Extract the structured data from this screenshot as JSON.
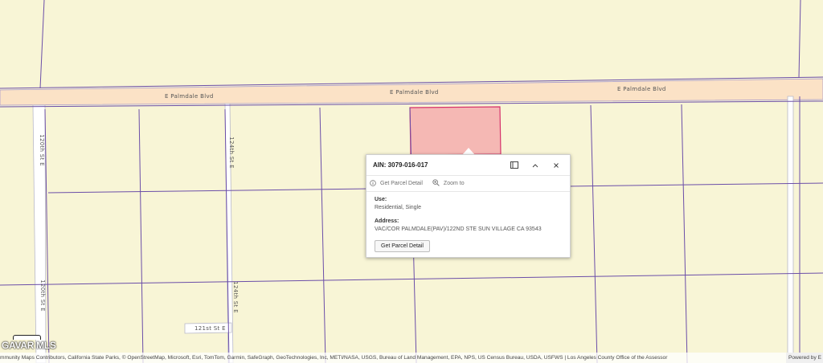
{
  "roads": {
    "palmdale_left": "E Palmdale Blvd",
    "palmdale_mid": "E Palmdale Blvd",
    "palmdale_right": "E Palmdale Blvd",
    "st_120th_top": "120th St E",
    "st_120th_bottom": "120th St E",
    "st_121st": "121st St E",
    "st_124th_top": "124th St E",
    "st_124th_bottom": "124th St E"
  },
  "popup": {
    "title": "AIN: 3079-016-017",
    "dock_icon": "dock-icon",
    "collapse_icon": "chevron-up-icon",
    "close_icon": "close-icon",
    "action_info_label": "Get Parcel Detail",
    "action_zoom_label": "Zoom to",
    "use_label": "Use:",
    "use_value": "Residential, Single",
    "address_label": "Address:",
    "address_value": "VAC/COR PALMDALE(PAV)/122ND STE SUN VILLAGE CA 93543",
    "detail_button": "Get Parcel Detail"
  },
  "attribution": "mmunity Maps Contributors, California State Parks, © OpenStreetMap, Microsoft, Esri, TomTom, Garmin, SafeGraph, GeoTechnologies, Inc, METI/NASA, USGS, Bureau of Land Management, EPA, NPS, US Census Bureau, USDA, USFWS | Los Angeles County Office of the Assessor",
  "powered_by": "Powered by E",
  "logo": "GAVAR MLS",
  "colors": {
    "background": "#f8f5d6",
    "parcel_line": "#6b4ea8",
    "road_fill": "#fbe2c6",
    "selected_parcel": "#f5b8b4",
    "selected_outline": "#d6336c"
  }
}
